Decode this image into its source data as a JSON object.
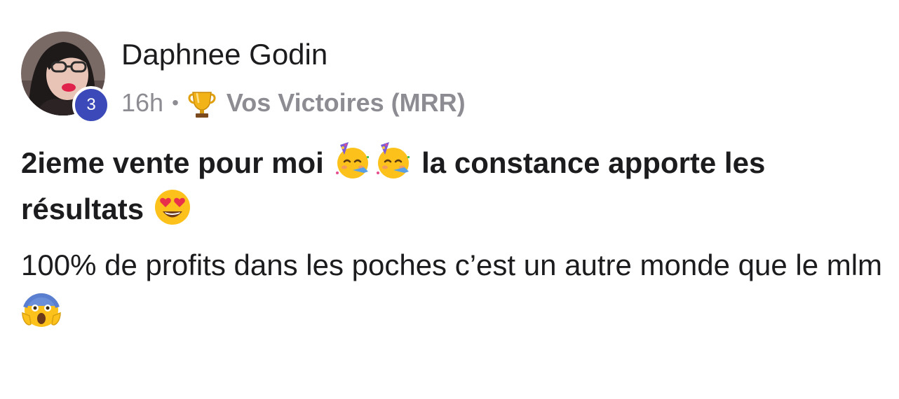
{
  "post": {
    "author": {
      "name": "Daphnee Godin",
      "level": "3",
      "avatar_icon": "profile-photo"
    },
    "meta": {
      "time": "16h",
      "separator": "•",
      "group_icon": "trophy-icon",
      "group": "Vos Victoires (MRR)"
    },
    "title": {
      "part1": "2ieme vente pour moi ",
      "emoji1": "partying-face-emoji",
      "emoji2": "partying-face-emoji",
      "part2": " la constance apporte les résultats ",
      "emoji3": "heart-eyes-emoji"
    },
    "body": {
      "text": "100% de profits dans les poches c’est un autre monde que le mlm ",
      "emoji": "screaming-face-emoji"
    }
  },
  "colors": {
    "badge": "#3b4ab8",
    "meta_text": "#8c8c92",
    "main_text": "#1c1c1e"
  }
}
